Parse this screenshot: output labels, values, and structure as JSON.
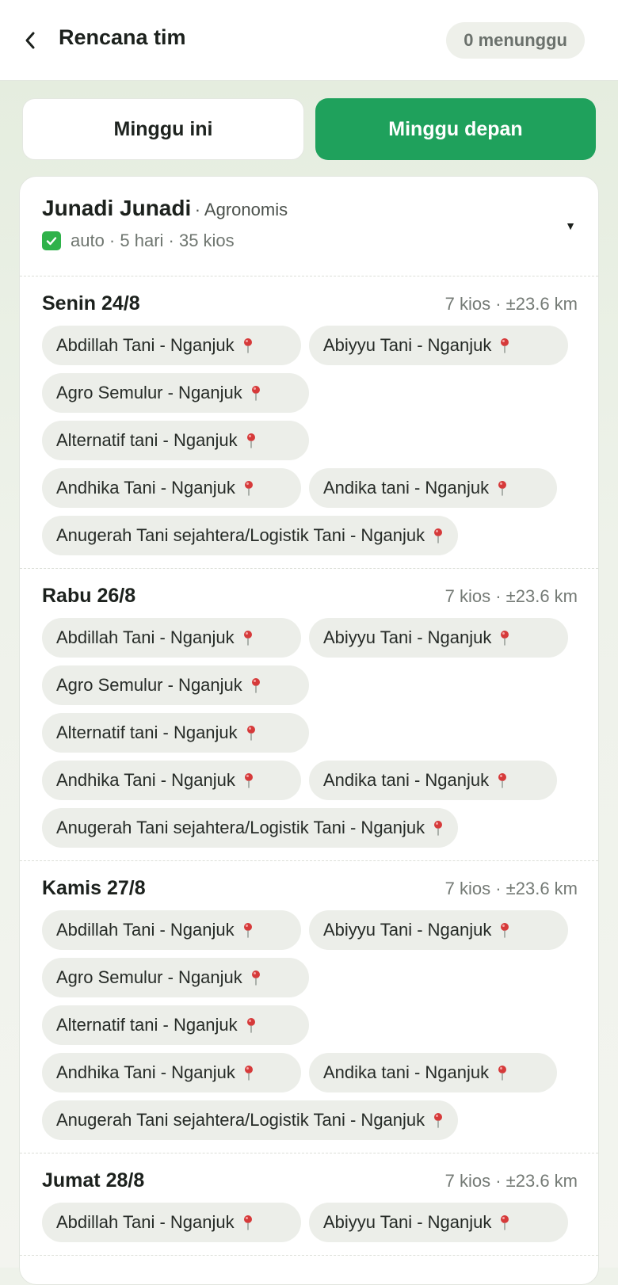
{
  "header": {
    "title": "Rencana tim",
    "pending_badge": "0 menunggu"
  },
  "tabs": [
    {
      "label": "Minggu ini",
      "active": false
    },
    {
      "label": "Minggu depan",
      "active": true
    }
  ],
  "member": {
    "name": "Junadi Junadi",
    "role": "· Agronomis",
    "meta": "auto · 5 hari · 35 kios"
  },
  "days": [
    {
      "title": "Senin 24/8",
      "summary": "7 kios · ±23.6 km",
      "kios": [
        "Abdillah Tani - Nganjuk",
        "Abiyyu Tani - Nganjuk",
        "Agro Semulur - Nganjuk",
        "Alternatif tani - Nganjuk",
        "Andhika Tani - Nganjuk",
        "Andika tani - Nganjuk",
        "Anugerah Tani sejahtera/Logistik Tani - Nganjuk"
      ]
    },
    {
      "title": "Rabu 26/8",
      "summary": "7 kios · ±23.6 km",
      "kios": [
        "Abdillah Tani - Nganjuk",
        "Abiyyu Tani - Nganjuk",
        "Agro Semulur - Nganjuk",
        "Alternatif tani - Nganjuk",
        "Andhika Tani - Nganjuk",
        "Andika tani - Nganjuk",
        "Anugerah Tani sejahtera/Logistik Tani - Nganjuk"
      ]
    },
    {
      "title": "Kamis 27/8",
      "summary": "7 kios · ±23.6 km",
      "kios": [
        "Abdillah Tani - Nganjuk",
        "Abiyyu Tani - Nganjuk",
        "Agro Semulur - Nganjuk",
        "Alternatif tani - Nganjuk",
        "Andhika Tani - Nganjuk",
        "Andika tani - Nganjuk",
        "Anugerah Tani sejahtera/Logistik Tani - Nganjuk"
      ]
    },
    {
      "title": "Jumat 28/8",
      "summary": "7 kios · ±23.6 km",
      "kios": [
        "Abdillah Tani - Nganjuk",
        "Abiyyu Tani - Nganjuk"
      ]
    }
  ],
  "icons": {
    "back": "chevron-left-icon",
    "check": "check-box-icon",
    "expand": "caret-down-icon",
    "pin": "map-pin-icon"
  },
  "colors": {
    "accent": "#1fa15c",
    "pin": "#d63a3a",
    "check": "#2fb24a"
  }
}
